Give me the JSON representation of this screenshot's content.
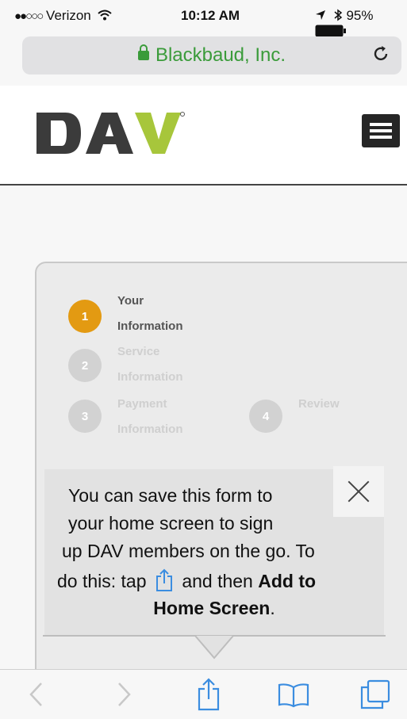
{
  "status_bar": {
    "signal_dots": "●●○○○",
    "carrier": "Verizon",
    "time": "10:12 AM",
    "battery": "95%"
  },
  "url_bar": {
    "domain": "Blackbaud, Inc."
  },
  "site": {
    "logo_text": "DAV"
  },
  "steps": [
    {
      "number": "1",
      "line1": "Your",
      "line2": "Information",
      "state": "active"
    },
    {
      "number": "2",
      "line1": "Service",
      "line2": "Information",
      "state": "inactive"
    },
    {
      "number": "3",
      "line1": "Payment",
      "line2": "Information",
      "state": "inactive"
    },
    {
      "number": "4",
      "line1": "Review",
      "line2": "",
      "state": "inactive"
    }
  ],
  "tooltip": {
    "line1": "You can save this form to",
    "line2": "your home screen to sign",
    "line3": "up DAV members on the go. To",
    "line4_prefix": "do this: tap",
    "line4_middle": "and then",
    "line4_bold": "Add to",
    "line5_bold": "Home Screen",
    "line5_suffix": "."
  },
  "colors": {
    "active_step": "#e39a12",
    "inactive_step": "#d2d2d2",
    "secure_green": "#3a9b3a",
    "ios_blue": "#3b8de0",
    "logo_dark": "#3b3b3b",
    "logo_green": "#a7c63b"
  },
  "toolbar_icons": [
    "back-icon",
    "forward-icon",
    "share-icon",
    "bookmarks-icon",
    "tabs-icon"
  ]
}
